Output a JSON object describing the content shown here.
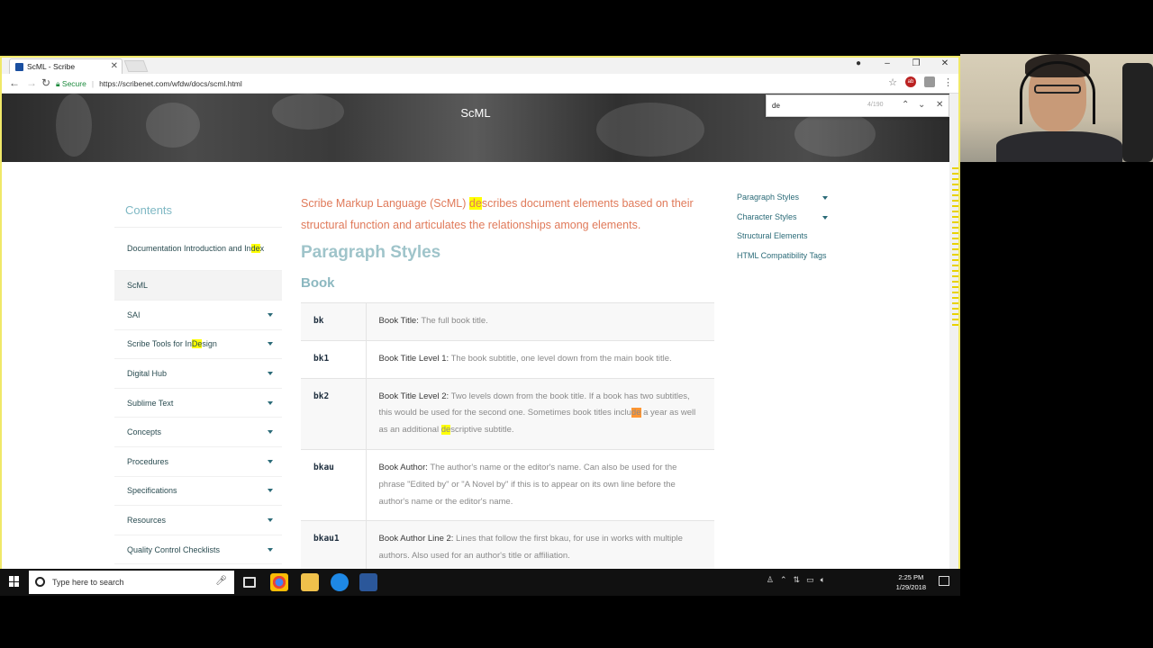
{
  "browser": {
    "tab_title": "ScML - Scribe",
    "secure_label": "Secure",
    "url": "https://scribenet.com/wfdw/docs/scml.html"
  },
  "hero": {
    "title": "ScML"
  },
  "find": {
    "query": "de",
    "count": "4/190"
  },
  "sidebar": {
    "heading": "Contents",
    "items": [
      {
        "label": "Documentation Introduction and Index"
      },
      {
        "label": "ScML"
      },
      {
        "label": "SAI"
      },
      {
        "label": "Scribe Tools for InDesign"
      },
      {
        "label": "Digital Hub"
      },
      {
        "label": "Sublime Text"
      },
      {
        "label": "Concepts"
      },
      {
        "label": "Procedures"
      },
      {
        "label": "Specifications"
      },
      {
        "label": "Resources"
      },
      {
        "label": "Quality Control Checklists"
      }
    ]
  },
  "main": {
    "intro": "Scribe Markup Language (ScML) describes document elements based on their structural function and articulates the relationships among elements.",
    "section_title": "Paragraph Styles",
    "subsection_title": "Book",
    "rows": [
      {
        "code": "bk",
        "term": "Book Title:",
        "desc": " The full book title."
      },
      {
        "code": "bk1",
        "term": "Book Title Level 1:",
        "desc": " The book subtitle, one level down from the main book title."
      },
      {
        "code": "bk2",
        "term": "Book Title Level 2:",
        "desc": " Two levels down from the book title. If a book has two subtitles, this would be used for the second one. Sometimes book titles include a year as well as an additional descriptive subtitle."
      },
      {
        "code": "bkau",
        "term": "Book Author:",
        "desc": " The author's name or the editor's name. Can also be used for the phrase \"Edited by\" or \"A Novel by\" if this is to appear on its own line before the author's name or the editor's name."
      },
      {
        "code": "bkau1",
        "term": "Book Author Line 2:",
        "desc": " Lines that follow the first bkau, for use in works with multiple authors. Also used for an author's title or affiliation."
      }
    ]
  },
  "toc_right": {
    "items": [
      {
        "label": "Paragraph Styles"
      },
      {
        "label": "Character Styles"
      },
      {
        "label": "Structural Elements"
      },
      {
        "label": "HTML Compatibility Tags"
      }
    ]
  },
  "taskbar": {
    "search_placeholder": "Type here to search",
    "time": "2:25 PM",
    "date": "1/29/2018"
  },
  "colors": {
    "accent_teal": "#7fb8c4",
    "intro_orange": "#e07a5a",
    "find_highlight": "#ffff00",
    "find_current": "#ff9632"
  }
}
